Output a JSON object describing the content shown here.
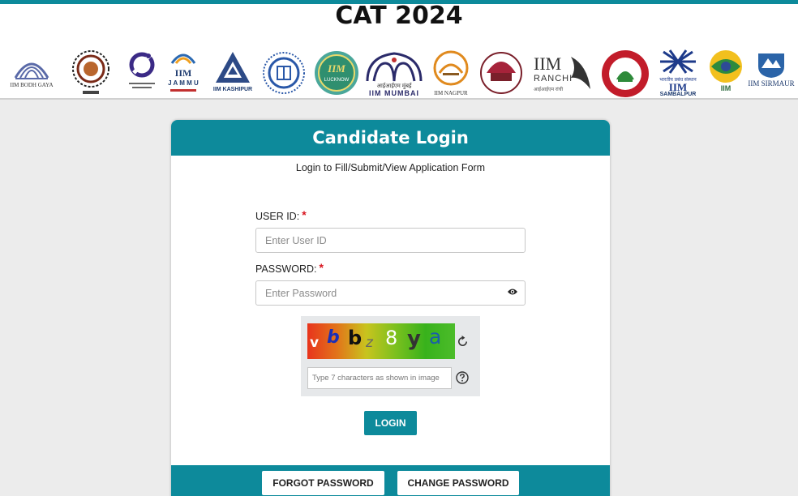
{
  "header": {
    "exam_title": "CAT 2024",
    "logos": [
      {
        "icon": "iim-bodh-gaya-logo",
        "caption": "IIM BODH GAYA"
      },
      {
        "icon": "iim-calcutta-logo",
        "caption": ""
      },
      {
        "icon": "iim-indore-logo",
        "caption": ""
      },
      {
        "icon": "iim-jammu-logo",
        "caption": ""
      },
      {
        "icon": "iim-kashipur-logo",
        "caption": "IIM KASHIPUR"
      },
      {
        "icon": "iim-kozhikode-logo",
        "caption": ""
      },
      {
        "icon": "iim-lucknow-logo",
        "caption": ""
      },
      {
        "icon": "iim-mumbai-logo",
        "caption": "IIM MUMBAI"
      },
      {
        "icon": "iim-nagpur-logo",
        "caption": "IIM NAGPUR"
      },
      {
        "icon": "iim-raipur-logo",
        "caption": ""
      },
      {
        "icon": "iim-ranchi-logo",
        "caption": "RANCHI"
      },
      {
        "icon": "iim-rohtak-logo",
        "caption": ""
      },
      {
        "icon": "iim-sambalpur-logo",
        "caption": "SAMBALPUR"
      },
      {
        "icon": "iim-shillong-logo",
        "caption": "IIM"
      },
      {
        "icon": "iim-sirmaur-logo",
        "caption": "IIM SIRMAUR"
      }
    ]
  },
  "login": {
    "title": "Candidate Login",
    "subtitle": "Login to Fill/Submit/View Application Form",
    "user_id_label": "USER ID:",
    "user_id_placeholder": "Enter User ID",
    "user_id_value": "",
    "password_label": "PASSWORD:",
    "password_placeholder": "Enter Password",
    "password_value": "",
    "required_mark": "*",
    "captcha_text": "vbbz8ya",
    "captcha_placeholder": "Type 7 characters as shown in image",
    "captcha_value": "",
    "login_button": "LOGIN"
  },
  "footer": {
    "forgot_password": "FORGOT PASSWORD",
    "change_password": "CHANGE PASSWORD"
  },
  "colors": {
    "accent": "#0d8a9b",
    "required": "#d8141e"
  }
}
